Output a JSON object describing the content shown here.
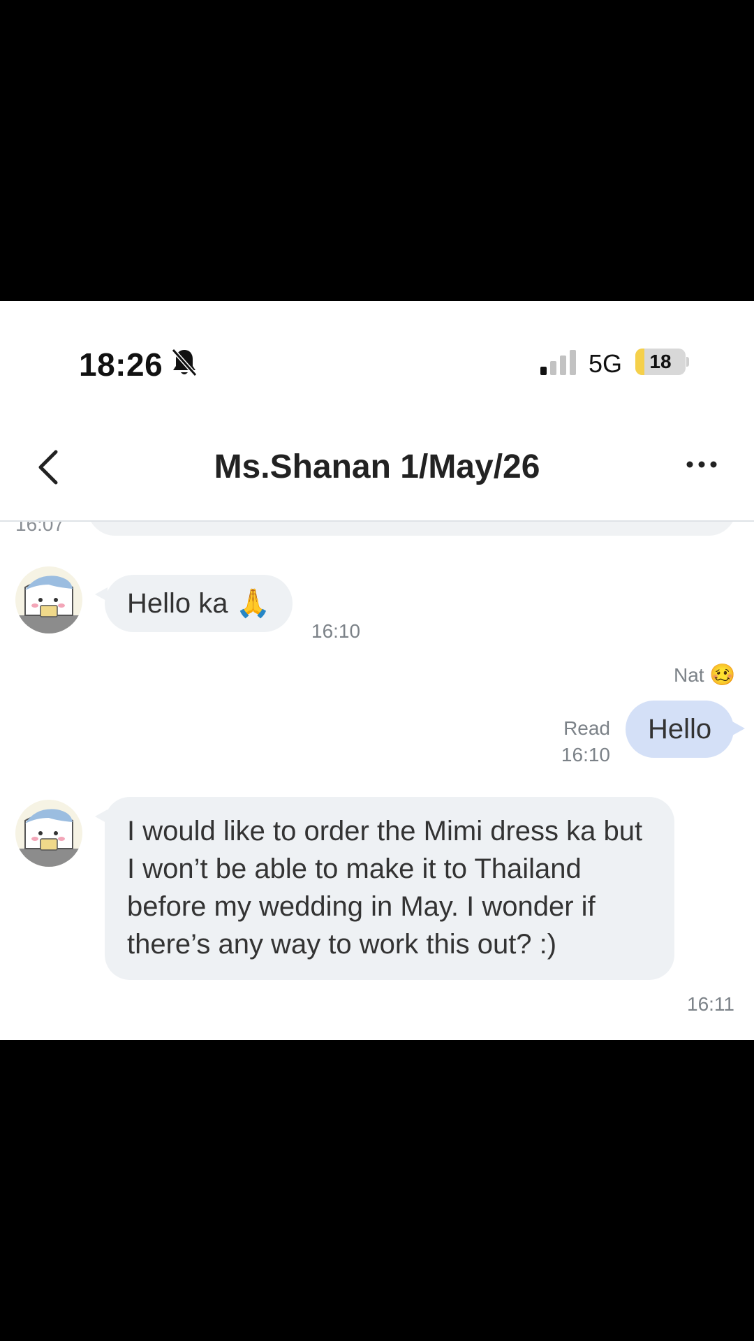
{
  "status_bar": {
    "time": "18:26",
    "network": "5G",
    "battery_level": "18",
    "battery_fraction": 0.18,
    "signal_bars_active": 1,
    "icons": [
      "bell-slash-icon",
      "signal-icon",
      "battery-icon"
    ]
  },
  "header": {
    "title": "Ms.Shanan 1/May/26",
    "back_icon": "chevron-left-icon",
    "more_icon": "more-horizontal-icon"
  },
  "chat": {
    "previous_message_time": "16:07",
    "messages": [
      {
        "direction": "incoming",
        "text": "Hello ka 🙏",
        "time": "16:10"
      },
      {
        "direction": "outgoing",
        "sender": "Nat",
        "sender_emoji": "🥴",
        "text": "Hello",
        "status": "Read",
        "time": "16:10"
      },
      {
        "direction": "incoming",
        "text": "I would like to order the Mimi dress ka but I won’t be able to make it to Thailand before my wedding in May. I wonder if there’s any way to work this out? :)",
        "time": "16:11"
      }
    ]
  },
  "colors": {
    "incoming_bubble": "#eef1f4",
    "outgoing_bubble": "#d4e0f7",
    "battery_fill": "#f5d04a",
    "letterbox": "#000000"
  }
}
